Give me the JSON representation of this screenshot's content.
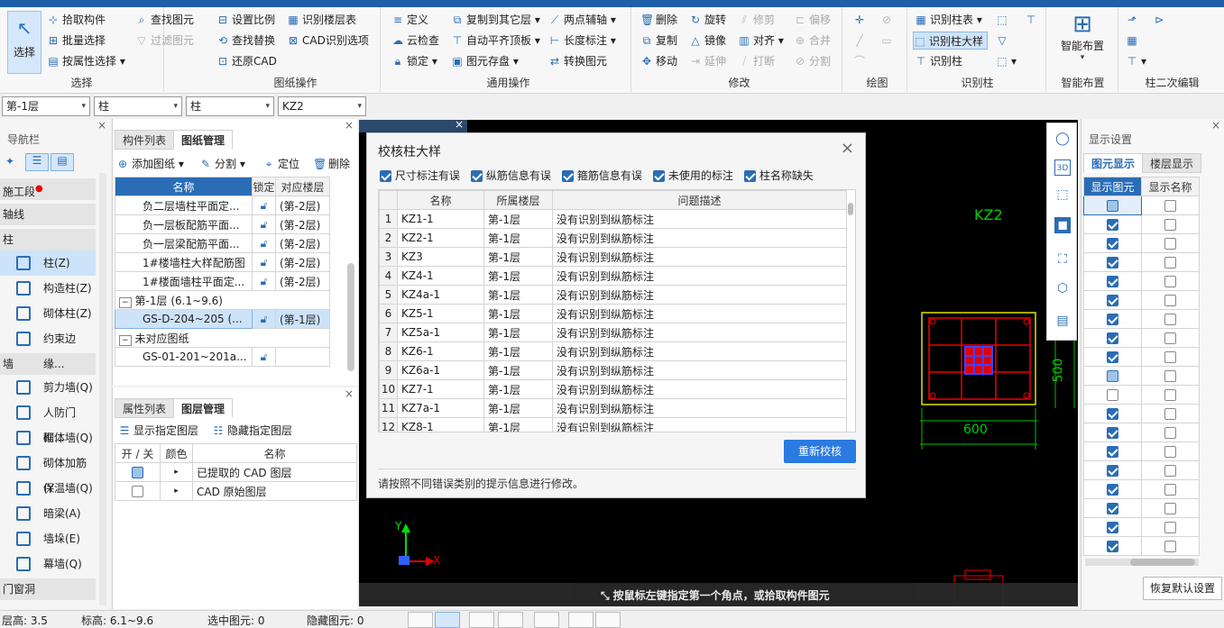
{
  "ribbon": {
    "select_label": "选择",
    "groups": {
      "select": {
        "label": "选择",
        "items": [
          "拾取构件",
          "批量选择",
          "按属性选择"
        ],
        "items2": [
          "查找图元",
          "过滤图元"
        ]
      },
      "drawing": {
        "label": "图纸操作",
        "items": [
          "设置比例",
          "查找替换",
          "还原CAD"
        ],
        "items2": [
          "识别楼层表",
          "CAD识别选项"
        ]
      },
      "common": {
        "label": "通用操作",
        "items": [
          "定义",
          "云检查",
          "锁定"
        ],
        "items2": [
          "复制到其它层",
          "自动平齐顶板",
          "图元存盘"
        ],
        "items3": [
          "两点辅轴",
          "长度标注",
          "转换图元"
        ]
      },
      "modify": {
        "label": "修改",
        "items": [
          "删除",
          "复制",
          "移动"
        ],
        "items2": [
          "旋转",
          "镜像",
          "延伸"
        ],
        "items3": [
          "修剪",
          "对齐",
          "打断"
        ],
        "items4": [
          "偏移",
          "合并",
          "分割"
        ]
      },
      "draw": {
        "label": "绘图"
      },
      "recognize": {
        "label": "识别柱",
        "items": [
          "识别柱表",
          "识别柱大样",
          "识别柱"
        ]
      },
      "smart": {
        "label": "智能布置",
        "btn": "智能布置"
      },
      "secondary": {
        "label": "柱二次编辑"
      }
    }
  },
  "selectors": [
    "第-1层",
    "柱",
    "柱",
    "KZ2"
  ],
  "nav": {
    "title": "导航栏",
    "sections": [
      {
        "label": "施工段"
      },
      {
        "label": "轴线"
      },
      {
        "label": "柱"
      }
    ],
    "column_items": [
      "柱(Z)",
      "构造柱(Z)",
      "砌体柱(Z)",
      "约束边缘..."
    ],
    "wall_section": "墙",
    "wall_items": [
      "剪力墙(Q)",
      "人防门框...",
      "砌体墙(Q)",
      "砌体加筋(Y",
      "保温墙(Q)",
      "暗梁(A)",
      "墙垛(E)",
      "幕墙(Q)"
    ],
    "door_section": "门窗洞"
  },
  "drawings": {
    "tabs": [
      "构件列表",
      "图纸管理"
    ],
    "toolbar": [
      "添加图纸",
      "分割",
      "定位",
      "删除"
    ],
    "headers": [
      "名称",
      "锁定",
      "对应楼层"
    ],
    "rows": [
      {
        "name": "负二层墙柱平面定...",
        "floor": "(第-2层)"
      },
      {
        "name": "负一层板配筋平面...",
        "floor": "(第-2层)"
      },
      {
        "name": "负一层梁配筋平面...",
        "floor": "(第-2层)"
      },
      {
        "name": "1#楼墙柱大样配筋图",
        "floor": "(第-2层)"
      },
      {
        "name": "1#楼面墙柱平面定...",
        "floor": "(第-2层)"
      }
    ],
    "group1": "第-1层 (6.1~9.6)",
    "group1_row": {
      "name": "GS-D-204~205 (...",
      "floor": "(第-1层)"
    },
    "group2": "未对应图纸",
    "group2_row": {
      "name": "GS-01-201~201a...",
      "floor": ""
    }
  },
  "layers": {
    "tabs": [
      "属性列表",
      "图层管理"
    ],
    "toolbar": [
      "显示指定图层",
      "隐藏指定图层"
    ],
    "headers": [
      "开 / 关",
      "颜色",
      "名称"
    ],
    "rows": [
      "已提取的 CAD 图层",
      "CAD 原始图层"
    ]
  },
  "dialog": {
    "title": "校核柱大样",
    "filters": [
      "尺寸标注有误",
      "纵筋信息有误",
      "箍筋信息有误",
      "未使用的标注",
      "柱名称缺失"
    ],
    "headers": [
      "名称",
      "所属楼层",
      "问题描述"
    ],
    "rows": [
      {
        "no": "1",
        "name": "KZ1-1",
        "floor": "第-1层",
        "desc": "没有识别到纵筋标注"
      },
      {
        "no": "2",
        "name": "KZ2-1",
        "floor": "第-1层",
        "desc": "没有识别到纵筋标注"
      },
      {
        "no": "3",
        "name": "KZ3",
        "floor": "第-1层",
        "desc": "没有识别到纵筋标注"
      },
      {
        "no": "4",
        "name": "KZ4-1",
        "floor": "第-1层",
        "desc": "没有识别到纵筋标注"
      },
      {
        "no": "5",
        "name": "KZ4a-1",
        "floor": "第-1层",
        "desc": "没有识别到纵筋标注"
      },
      {
        "no": "6",
        "name": "KZ5-1",
        "floor": "第-1层",
        "desc": "没有识别到纵筋标注"
      },
      {
        "no": "7",
        "name": "KZ5a-1",
        "floor": "第-1层",
        "desc": "没有识别到纵筋标注"
      },
      {
        "no": "8",
        "name": "KZ6-1",
        "floor": "第-1层",
        "desc": "没有识别到纵筋标注"
      },
      {
        "no": "9",
        "name": "KZ6a-1",
        "floor": "第-1层",
        "desc": "没有识别到纵筋标注"
      },
      {
        "no": "10",
        "name": "KZ7-1",
        "floor": "第-1层",
        "desc": "没有识别到纵筋标注"
      },
      {
        "no": "11",
        "name": "KZ7a-1",
        "floor": "第-1层",
        "desc": "没有识别到纵筋标注"
      },
      {
        "no": "12",
        "name": "KZ8-1",
        "floor": "第-1层",
        "desc": "没有识别到纵筋标注"
      }
    ],
    "recheck": "重新校核",
    "hint": "请按照不同错误类别的提示信息进行修改。"
  },
  "canvas": {
    "label_kz": "KZ2",
    "dim_width": "600",
    "dim_height": "500",
    "hint": "按鼠标左键指定第一个角点，或拾取构件图元",
    "axis_x": "X",
    "axis_y": "Y"
  },
  "display": {
    "title": "显示设置",
    "tabs": [
      "图元显示",
      "楼层显示"
    ],
    "headers": [
      "显示图元",
      "显示名称"
    ],
    "restore": "恢复默认设置"
  },
  "status": {
    "floor_height": "层高:  3.5",
    "elevation": "标高:  6.1~9.6",
    "selected": "选中图元:  0",
    "hidden": "隐藏图元:  0"
  }
}
